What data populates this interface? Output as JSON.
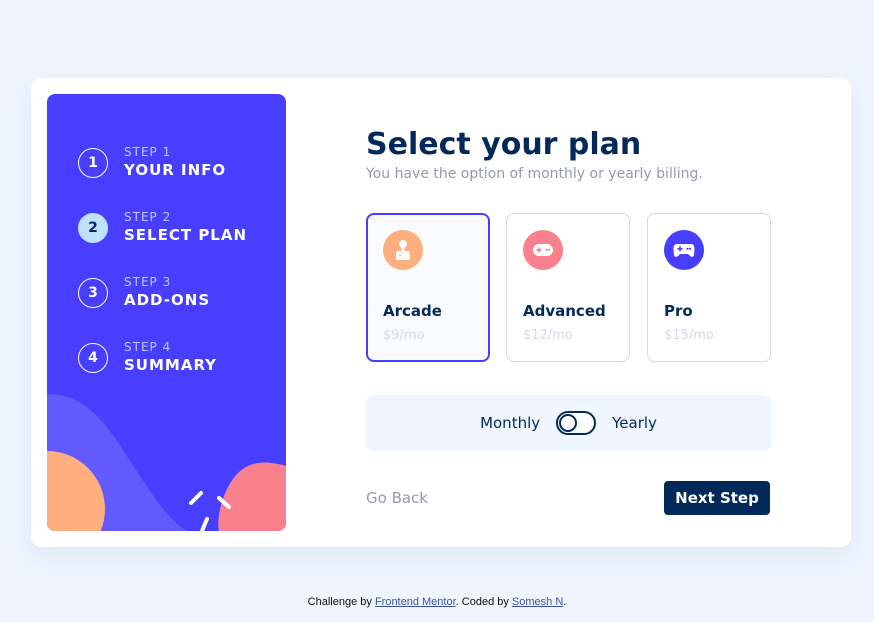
{
  "sidebar": {
    "steps": [
      {
        "number": "1",
        "label": "STEP 1",
        "title": "YOUR INFO",
        "active": false
      },
      {
        "number": "2",
        "label": "STEP 2",
        "title": "SELECT PLAN",
        "active": true
      },
      {
        "number": "3",
        "label": "STEP 3",
        "title": "ADD-ONS",
        "active": false
      },
      {
        "number": "4",
        "label": "STEP 4",
        "title": "SUMMARY",
        "active": false
      }
    ]
  },
  "main": {
    "title": "Select your plan",
    "subtitle": "You have the option of monthly or yearly billing."
  },
  "plans": [
    {
      "name": "Arcade",
      "price": "$9/mo",
      "icon": "arcade-icon",
      "icon_color": "#ffaf7e",
      "selected": true
    },
    {
      "name": "Advanced",
      "price": "$12/mo",
      "icon": "advanced-gamepad-icon",
      "icon_color": "#f9818e",
      "selected": false
    },
    {
      "name": "Pro",
      "price": "$15/mo",
      "icon": "pro-gamepad-icon",
      "icon_color": "#483eff",
      "selected": false
    }
  ],
  "billing": {
    "monthly_label": "Monthly",
    "yearly_label": "Yearly",
    "selected": "monthly"
  },
  "buttons": {
    "back_label": "Go Back",
    "next_label": "Next Step"
  },
  "footer": {
    "prefix": "Challenge by ",
    "link1": "Frontend Mentor",
    "middle": ". Coded by ",
    "link2": "Somesh N",
    "suffix": "."
  },
  "colors": {
    "accent": "#483eff",
    "primary_dark": "#02295a",
    "muted": "#9699ab",
    "border": "#d6d9e6",
    "active_step": "#bee2fd"
  }
}
